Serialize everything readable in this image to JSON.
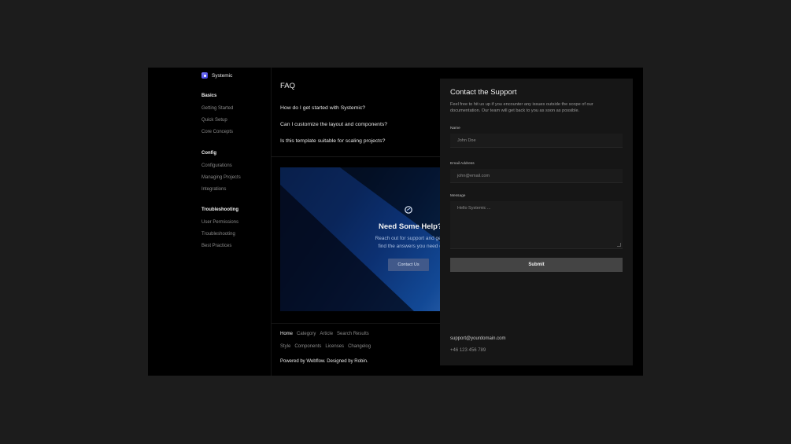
{
  "brand": {
    "name": "Systemic"
  },
  "sidebar": {
    "groups": [
      {
        "heading": "Basics",
        "items": [
          "Getting Started",
          "Quick Setup",
          "Core Concepts"
        ]
      },
      {
        "heading": "Config",
        "items": [
          "Configurations",
          "Managing Projects",
          "Integrations"
        ]
      },
      {
        "heading": "Troubleshooting",
        "items": [
          "User Permissions",
          "Troubleshooting",
          "Best Practices"
        ]
      }
    ]
  },
  "faq": {
    "title": "FAQ",
    "questions": [
      "How do I get started with Systemic?",
      "Can I customize the layout and components?",
      "Is this template suitable for scaling projects?"
    ]
  },
  "help_card": {
    "icon": "sync-logo-icon",
    "title": "Need Some Help?",
    "subtitle_line1": "Reach out for support and get in",
    "subtitle_line2": "find the answers you need qu",
    "button_label": "Contact Us"
  },
  "footer": {
    "links_row1": [
      "Home",
      "Category",
      "Article",
      "Search Results"
    ],
    "links_row2": [
      "Style",
      "Components",
      "Licenses",
      "Changelog"
    ],
    "powered": "Powered by Webflow. Designed by Robin."
  },
  "contact_panel": {
    "title": "Contact the Support",
    "description": "Feel free to hit us up if you encounter any issues outside the scope of our documentation. Our team will get back to you as soon as possible.",
    "name_label": "Name",
    "name_placeholder": "John Doe",
    "email_label": "Email Address",
    "email_placeholder": "john@email.com",
    "message_label": "Message",
    "message_placeholder": "Hello Systemic ...",
    "submit_label": "Submit",
    "support_email": "support@yourdomain.com",
    "support_phone": "+46 123 456 789"
  }
}
